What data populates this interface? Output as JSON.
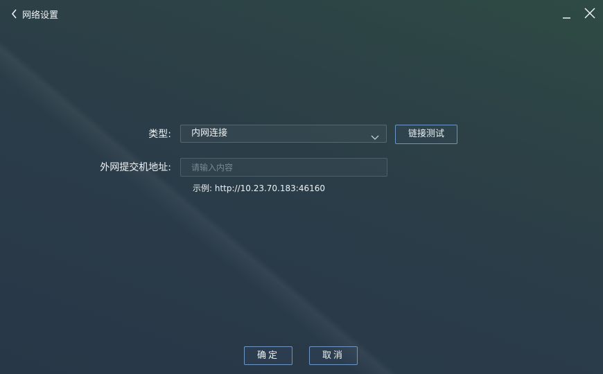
{
  "window": {
    "title": "网络设置",
    "back_icon": "chevron-left-icon",
    "minimize_icon": "minimize-icon",
    "close_icon": "close-icon"
  },
  "form": {
    "type_label": "类型:",
    "type_value": "内网连接",
    "dropdown_icon": "chevron-down-icon",
    "test_button": "链接测试",
    "address_label": "外网提交机地址:",
    "address_value": "",
    "address_placeholder": "请输入内容",
    "example_hint": "示例: http://10.23.70.183:46160"
  },
  "footer": {
    "confirm_label": "确定",
    "cancel_label": "取消"
  },
  "colors": {
    "accent_border": "#6e96c4",
    "background": "#2b3d48"
  }
}
